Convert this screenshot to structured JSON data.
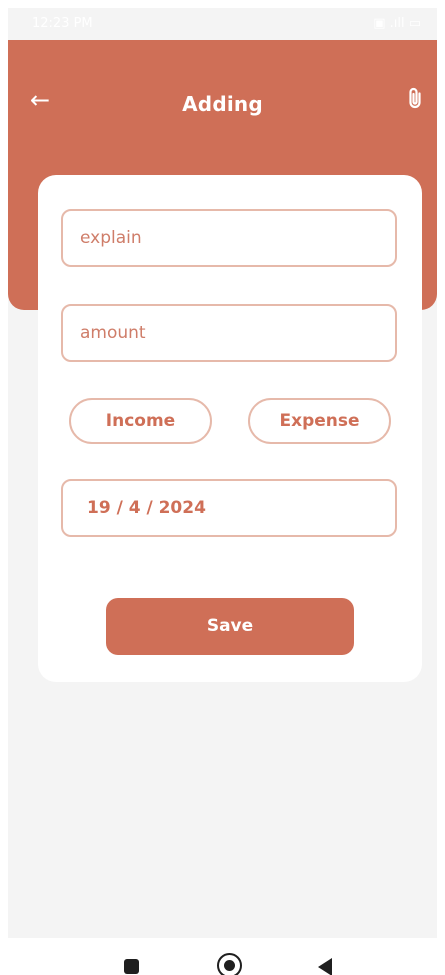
{
  "status_bar": {
    "time": "12:23 PM",
    "icons": "◍ ● ➤",
    "right_icons": "▣ .ıll ▭"
  },
  "header": {
    "title": "Adding",
    "back_icon": "arrow-left-icon",
    "attach_icon": "paperclip-icon"
  },
  "form": {
    "explain_placeholder": "explain",
    "amount_placeholder": "amount",
    "income_label": "Income",
    "expense_label": "Expense",
    "date_value": "19 / 4 / 2024",
    "save_label": "Save"
  },
  "colors": {
    "accent": "#cf6f57",
    "border": "#e6b9aa",
    "background": "#f4f4f4"
  }
}
